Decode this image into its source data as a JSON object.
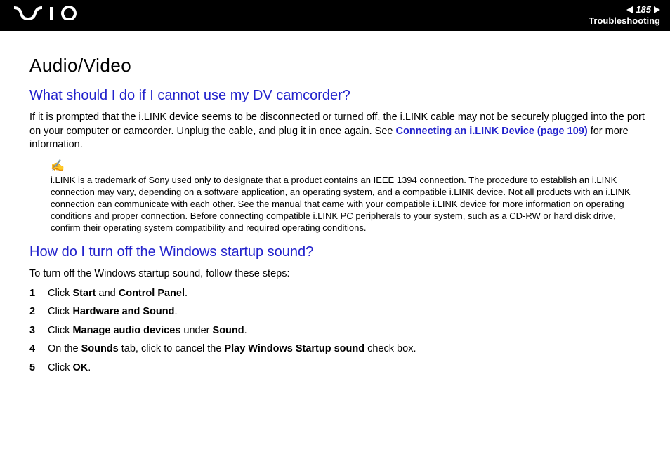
{
  "header": {
    "page_number": "185",
    "section": "Troubleshooting"
  },
  "title": "Audio/Video",
  "q1": {
    "heading": "What should I do if I cannot use my DV camcorder?",
    "p1_a": "If it is prompted that the i.LINK device seems to be disconnected or turned off, the i.LINK cable may not be securely plugged into the port on your computer or camcorder. Unplug the cable, and plug it in once again. See ",
    "p1_link": "Connecting an i.LINK Device (page 109)",
    "p1_b": " for more information.",
    "note": "i.LINK is a trademark of Sony used only to designate that a product contains an IEEE 1394 connection. The procedure to establish an i.LINK connection may vary, depending on a software application, an operating system, and a compatible i.LINK device. Not all products with an i.LINK connection can communicate with each other. See the manual that came with your compatible i.LINK device for more information on operating conditions and proper connection. Before connecting compatible i.LINK PC peripherals to your system, such as a CD-RW or hard disk drive, confirm their operating system compatibility and required operating conditions."
  },
  "q2": {
    "heading": "How do I turn off the Windows startup sound?",
    "intro": "To turn off the Windows startup sound, follow these steps:",
    "steps": [
      {
        "n": "1",
        "a": "Click ",
        "b1": "Start",
        "mid": " and ",
        "b2": "Control Panel",
        "end": "."
      },
      {
        "n": "2",
        "a": "Click ",
        "b1": "Hardware and Sound",
        "end": "."
      },
      {
        "n": "3",
        "a": "Click ",
        "b1": "Manage audio devices",
        "mid": " under ",
        "b2": "Sound",
        "end": "."
      },
      {
        "n": "4",
        "a": "On the ",
        "b1": "Sounds",
        "mid": " tab, click to cancel the ",
        "b2": "Play Windows Startup sound",
        "end": " check box."
      },
      {
        "n": "5",
        "a": "Click ",
        "b1": "OK",
        "end": "."
      }
    ]
  }
}
